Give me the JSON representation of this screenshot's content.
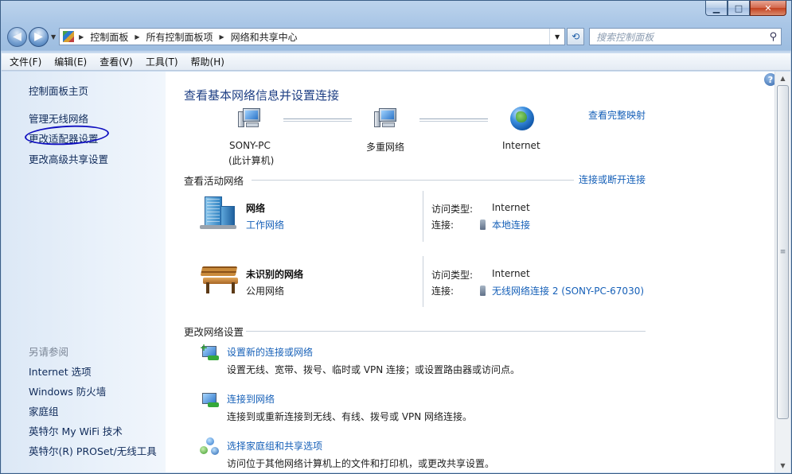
{
  "window": {
    "minimize": "▁",
    "maximize": "□",
    "close": "✕"
  },
  "nav": {
    "back_icon": "left-arrow",
    "forward_icon": "right-arrow",
    "breadcrumb": [
      "控制面板",
      "所有控制面板项",
      "网络和共享中心"
    ],
    "search_placeholder": "搜索控制面板"
  },
  "menu": [
    "文件(F)",
    "编辑(E)",
    "查看(V)",
    "工具(T)",
    "帮助(H)"
  ],
  "sidebar": {
    "home": "控制面板主页",
    "links": [
      "管理无线网络",
      "更改适配器设置",
      "更改高级共享设置"
    ],
    "see_also_title": "另请参阅",
    "see_also": [
      "Internet 选项",
      "Windows 防火墙",
      "家庭组",
      "英特尔 My WiFi 技术",
      "英特尔(R) PROSet/无线工具"
    ]
  },
  "main": {
    "heading": "查看基本网络信息并设置连接",
    "full_map_link": "查看完整映射",
    "map": {
      "computer_name": "SONY-PC",
      "computer_sub": "(此计算机)",
      "middle": "多重网络",
      "internet": "Internet"
    },
    "active_title": "查看活动网络",
    "connect_link": "连接或断开连接",
    "networks": [
      {
        "name": "网络",
        "type": "工作网络",
        "type_is_link": true,
        "access_label": "访问类型:",
        "access_value": "Internet",
        "conn_label": "连接:",
        "conn_value": "本地连接"
      },
      {
        "name": "未识别的网络",
        "type": "公用网络",
        "type_is_link": false,
        "access_label": "访问类型:",
        "access_value": "Internet",
        "conn_label": "连接:",
        "conn_value": "无线网络连接 2 (SONY-PC-67030)"
      }
    ],
    "change_title": "更改网络设置",
    "tasks": [
      {
        "link": "设置新的连接或网络",
        "desc": "设置无线、宽带、拨号、临时或 VPN 连接；或设置路由器或访问点。"
      },
      {
        "link": "连接到网络",
        "desc": "连接到或重新连接到无线、有线、拨号或 VPN 网络连接。"
      },
      {
        "link": "选择家庭组和共享选项",
        "desc": "访问位于其他网络计算机上的文件和打印机，或更改共享设置。"
      }
    ]
  },
  "colors": {
    "link": "#1660b8",
    "heading": "#1e3f84",
    "annotation_circle": "#1010c0"
  }
}
